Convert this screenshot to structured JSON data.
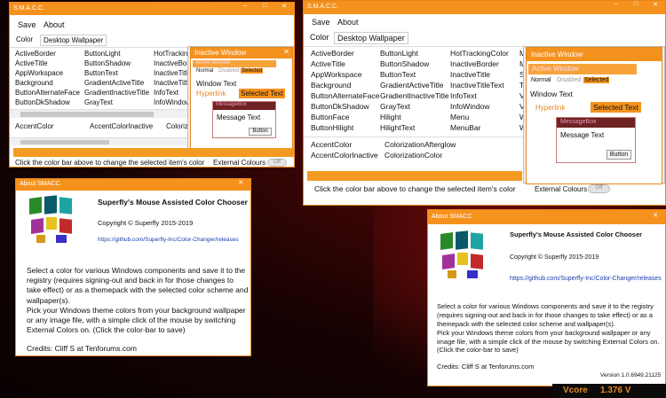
{
  "colors": {
    "accent": "#f5921e",
    "link": "#1a3eb0",
    "messagebox": "#6e2222"
  },
  "main": {
    "title": "S.M.A.C.C.",
    "menu": {
      "save": "Save",
      "about": "About"
    },
    "tabs": {
      "color": "Color",
      "wallpaper": "Desktop Wallpaper"
    },
    "col1": [
      "ActiveBorder",
      "ActiveTitle",
      "AppWorkspace",
      "Background",
      "ButtonAlternateFace",
      "ButtonDkShadow",
      "ButtonFace",
      "ButtonHilight"
    ],
    "col2": [
      "ButtonLight",
      "ButtonShadow",
      "ButtonText",
      "GradientActiveTitle",
      "GradientInactiveTitle",
      "GrayText",
      "Hilight",
      "HilightText"
    ],
    "col3": [
      "HotTrackingColor",
      "InactiveBorder",
      "InactiveTitle",
      "InactiveTitleText",
      "InfoText",
      "InfoWindow",
      "Menu",
      "MenuBar"
    ],
    "col4": [
      "M",
      "M",
      "S",
      "T",
      "V",
      "V",
      "W",
      "W"
    ],
    "accents": [
      [
        "AccentColor",
        "ColorizationAfterglow"
      ],
      [
        "AccentColorInactive",
        "ColorizationColor"
      ]
    ],
    "small_accents": [
      "AccentColor",
      "AccentColorInactive",
      "Colorizat"
    ],
    "preview": {
      "inactive_title": "Inactive Window",
      "active_title": "Active Window",
      "normal": "Normal",
      "disabled": "Disabled",
      "selected": "Selected",
      "window_text": "Window Text",
      "hyperlink": "Hyperlink",
      "selected_text": "Selected Text",
      "messagebox_title": "MessageBox",
      "message_text": "Message Text",
      "button": "Button"
    },
    "status": "Click the color bar above to change the selected item's color",
    "external": "External Colours",
    "toggle": "Off"
  },
  "about": {
    "title": "About SMACC",
    "app_title": "Superfly's Mouse Assisted Color Chooser",
    "copyright": "Copyright © Superfly 2015-2019",
    "link": "https://github.com/Superfly-Inc/Color-Changer/releases",
    "description": "Select a color for various Windows components and save it to the registry (requires signing-out and back in for those changes to take effect) or as a themepack with the selected color scheme and wallpaper(s).\nPick your Windows theme colors from your background wallpaper or any image file, with a simple click of the mouse by switching External Colors on. (Click the color-bar to save)",
    "credits": "Credits: Cliff S at Tenforums.com",
    "version": "Version 1.0.6949.21125"
  },
  "overlay": {
    "label": "Vcore",
    "value": "1.376 V"
  }
}
